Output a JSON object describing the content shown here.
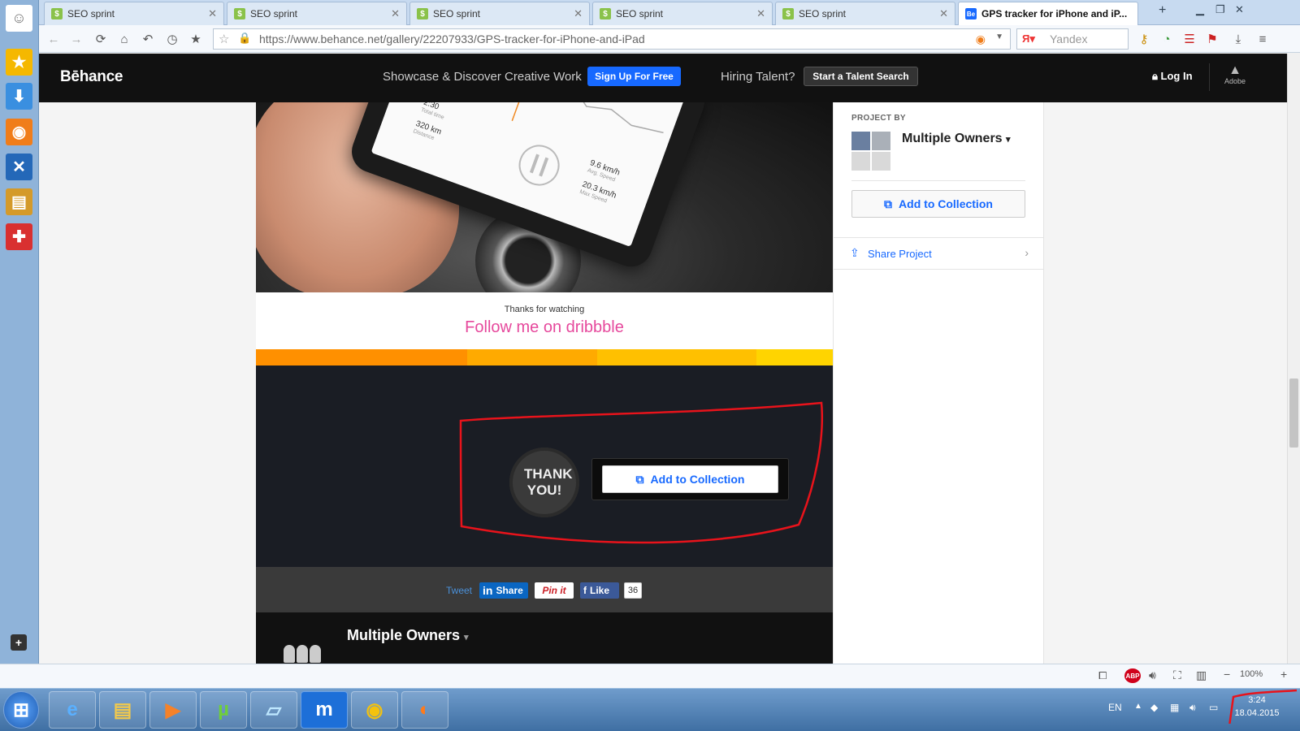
{
  "browser": {
    "tabs": [
      {
        "label": "SEO sprint",
        "active": false
      },
      {
        "label": "SEO sprint",
        "active": false
      },
      {
        "label": "SEO sprint",
        "active": false
      },
      {
        "label": "SEO sprint",
        "active": false
      },
      {
        "label": "SEO sprint",
        "active": false
      },
      {
        "label": "GPS tracker for iPhone and iP...",
        "active": true
      }
    ],
    "url": "https://www.behance.net/gallery/22207933/GPS-tracker-for-iPhone-and-iPad",
    "search_placeholder": "Yandex",
    "zoom": "100%"
  },
  "behance": {
    "logo": "Bēhance",
    "tagline": "Showcase & Discover Creative Work",
    "signup_label": "Sign Up For Free",
    "hiring_label": "Hiring Talent?",
    "talent_label": "Start a Talent Search",
    "login_label": "Log In",
    "adobe_label": "Adobe"
  },
  "project": {
    "thanks_small": "Thanks for watching",
    "follow_link": "Follow me on dribbble",
    "thank_you": "THANK YOU!",
    "add_collection": "Add to Collection",
    "social": {
      "tweet": "Tweet",
      "linkedin": "Share",
      "pinterest": "Pin it",
      "facebook": "Like",
      "like_count": "36"
    },
    "owners_title": "Multiple Owners",
    "phone": {
      "time": "2:30",
      "time_label": "Total time",
      "distance": "320 km",
      "distance_label": "Distance",
      "avg_speed": "9.6 km/h",
      "avg_label": "Avg. Speed",
      "max_speed": "20.3 km/h",
      "max_label": "Max Speed"
    }
  },
  "sidebar": {
    "project_by": "PROJECT BY",
    "owners": "Multiple Owners",
    "add_collection": "Add to Collection",
    "share_project": "Share Project"
  },
  "taskbar": {
    "lang": "EN",
    "time": "3:24",
    "date": "18.04.2015"
  },
  "colors": {
    "behance_blue": "#1769ff",
    "dribbble_pink": "#e6489c",
    "annotation_red": "#e8131b",
    "stripe": [
      "#ff9000",
      "#ffaa00",
      "#ffc000",
      "#ffd400"
    ]
  }
}
